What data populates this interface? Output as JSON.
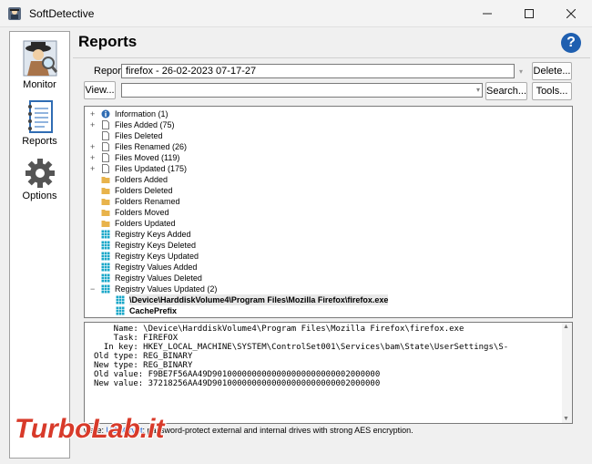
{
  "window": {
    "title": "SoftDetective",
    "min_glyph": "—",
    "max_glyph": "☐",
    "close_glyph": "✕"
  },
  "sidebar": {
    "items": [
      {
        "label": "Monitor",
        "icon": "spy-detective-icon"
      },
      {
        "label": "Reports",
        "icon": "notebook-icon"
      },
      {
        "label": "Options",
        "icon": "gear-icon"
      }
    ]
  },
  "header": {
    "title": "Reports",
    "help_glyph": "?"
  },
  "form": {
    "report_label": "Report:",
    "report_value": "firefox - 26-02-2023 07-17-27",
    "delete_label": "Delete...",
    "view_label": "View...",
    "view_value": "",
    "search_label": "Search...",
    "tools_label": "Tools..."
  },
  "tree": {
    "items": [
      {
        "label": "Information (1)",
        "expander": "+",
        "icon": "info-icon",
        "level": 0
      },
      {
        "label": "Files Added (75)",
        "expander": "+",
        "icon": "file-icon",
        "level": 0
      },
      {
        "label": "Files Deleted",
        "expander": "",
        "icon": "file-icon",
        "level": 0
      },
      {
        "label": "Files Renamed (26)",
        "expander": "+",
        "icon": "file-icon",
        "level": 0
      },
      {
        "label": "Files Moved (119)",
        "expander": "+",
        "icon": "file-icon",
        "level": 0
      },
      {
        "label": "Files Updated (175)",
        "expander": "+",
        "icon": "file-icon",
        "level": 0
      },
      {
        "label": "Folders Added",
        "expander": "",
        "icon": "folder-icon",
        "level": 0
      },
      {
        "label": "Folders Deleted",
        "expander": "",
        "icon": "folder-icon",
        "level": 0
      },
      {
        "label": "Folders Renamed",
        "expander": "",
        "icon": "folder-icon",
        "level": 0
      },
      {
        "label": "Folders Moved",
        "expander": "",
        "icon": "folder-icon",
        "level": 0
      },
      {
        "label": "Folders Updated",
        "expander": "",
        "icon": "folder-icon",
        "level": 0
      },
      {
        "label": "Registry Keys Added",
        "expander": "",
        "icon": "registry-icon",
        "level": 0
      },
      {
        "label": "Registry Keys Deleted",
        "expander": "",
        "icon": "registry-icon",
        "level": 0
      },
      {
        "label": "Registry Keys Updated",
        "expander": "",
        "icon": "registry-icon",
        "level": 0
      },
      {
        "label": "Registry Values Added",
        "expander": "",
        "icon": "registry-icon",
        "level": 0
      },
      {
        "label": "Registry Values Deleted",
        "expander": "",
        "icon": "registry-icon",
        "level": 0
      },
      {
        "label": "Registry Values Updated (2)",
        "expander": "−",
        "icon": "registry-icon",
        "level": 0
      },
      {
        "label": "\\Device\\HarddiskVolume4\\Program Files\\Mozilla Firefox\\firefox.exe",
        "expander": "",
        "icon": "registry-icon",
        "level": 1,
        "bold": true,
        "selected": true
      },
      {
        "label": "CachePrefix",
        "expander": "",
        "icon": "registry-icon",
        "level": 1,
        "bold": true
      }
    ]
  },
  "detail": {
    "lines": [
      "    Name: \\Device\\HarddiskVolume4\\Program Files\\Mozilla Firefox\\firefox.exe",
      "    Task: FIREFOX",
      "  In key: HKEY_LOCAL_MACHINE\\SYSTEM\\ControlSet001\\Services\\bam\\State\\UserSettings\\S-",
      "Old type: REG_BINARY",
      "New type: REG_BINARY",
      "Old value: F9BE7F56AA49D9010000000000000000000000002000000",
      "New value: 37218256AA49D9010000000000000000000000002000000"
    ],
    "scroll_up": "▲",
    "scroll_down": "▼"
  },
  "footer": {
    "prefix": "ware: ",
    "link": "USBCrypt",
    "text": ": password-protect external and internal drives with strong AES encryption."
  },
  "watermark": {
    "text": "TurboLab.it"
  },
  "colors": {
    "accent": "#1f5fb0",
    "link": "#1a5ed8",
    "folder": "#e8b34b",
    "registry": "#1aa7c8",
    "watermark_red": "#d83a2a"
  }
}
